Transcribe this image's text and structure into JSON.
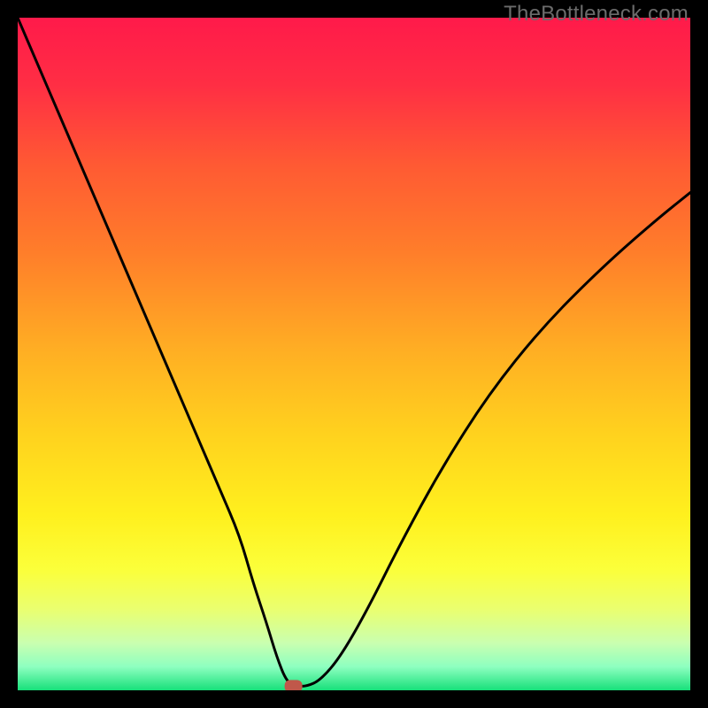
{
  "watermark": "TheBottleneck.com",
  "gradient": {
    "stops": [
      {
        "offset": 0.0,
        "color": "#ff1a4a"
      },
      {
        "offset": 0.1,
        "color": "#ff2e44"
      },
      {
        "offset": 0.22,
        "color": "#ff5a33"
      },
      {
        "offset": 0.35,
        "color": "#ff7e2a"
      },
      {
        "offset": 0.5,
        "color": "#ffb023"
      },
      {
        "offset": 0.62,
        "color": "#ffd21e"
      },
      {
        "offset": 0.74,
        "color": "#fff01e"
      },
      {
        "offset": 0.82,
        "color": "#fbff3a"
      },
      {
        "offset": 0.88,
        "color": "#eaff70"
      },
      {
        "offset": 0.93,
        "color": "#c9ffb0"
      },
      {
        "offset": 0.965,
        "color": "#8effc0"
      },
      {
        "offset": 1.0,
        "color": "#17e07a"
      }
    ]
  },
  "chart_data": {
    "type": "line",
    "title": "",
    "xlabel": "",
    "ylabel": "",
    "xlim": [
      0,
      100
    ],
    "ylim": [
      0,
      100
    ],
    "series": [
      {
        "name": "curve",
        "x": [
          0,
          3,
          6,
          9,
          12,
          15,
          18,
          21,
          24,
          27,
          30,
          33,
          35,
          37,
          38.5,
          40,
          41.5,
          43,
          45,
          48,
          52,
          57,
          63,
          70,
          78,
          87,
          95,
          100
        ],
        "y": [
          100,
          93,
          86,
          79,
          72,
          65,
          58,
          51,
          44,
          37,
          30,
          23,
          16,
          10,
          5,
          1.2,
          0.6,
          0.6,
          1.5,
          5,
          12,
          22,
          33,
          44,
          54,
          63,
          70,
          74
        ]
      }
    ],
    "marker": {
      "x": 41,
      "y": 0.6,
      "color": "#c0584a"
    }
  }
}
